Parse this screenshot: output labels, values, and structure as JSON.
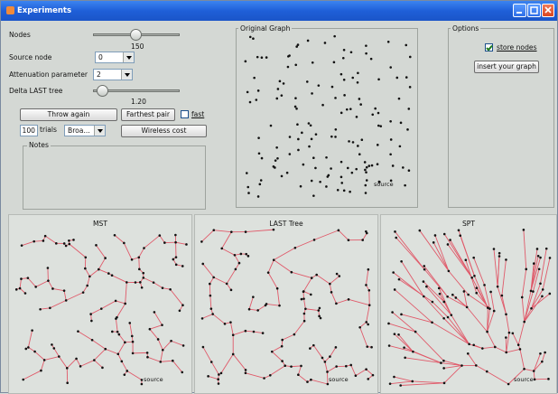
{
  "window": {
    "title": "Experiments"
  },
  "controls": {
    "nodes_label": "Nodes",
    "nodes_value": "150",
    "nodes_level": 0.5,
    "source_label": "Source node",
    "source_value": "0",
    "attenuation_label": "Attenuation parameter",
    "attenuation_value": "2",
    "delta_label": "Delta LAST tree",
    "delta_value": "1.20",
    "delta_level": 0.05,
    "throw_again": "Throw again",
    "farthest_pair": "Farthest pair",
    "fast_label": "fast",
    "trials_value": "100",
    "trials_label": "trials",
    "broadcast_value": "Broa...",
    "wireless_cost": "Wireless cost",
    "notes_label": "Notes"
  },
  "original_graph": {
    "title": "Original Graph",
    "source_label": "source"
  },
  "options": {
    "title": "Options",
    "store_nodes_label": "store nodes",
    "store_nodes_checked": true,
    "insert_graph": "insert your graph"
  },
  "trees": [
    {
      "title": "MST",
      "source_label": "source"
    },
    {
      "title": "LAST Tree",
      "source_label": "source"
    },
    {
      "title": "SPT",
      "source_label": "source"
    }
  ],
  "colors": {
    "title_bar": "#1f5fd8",
    "edge": "#e05a6a",
    "node": "#111111"
  }
}
